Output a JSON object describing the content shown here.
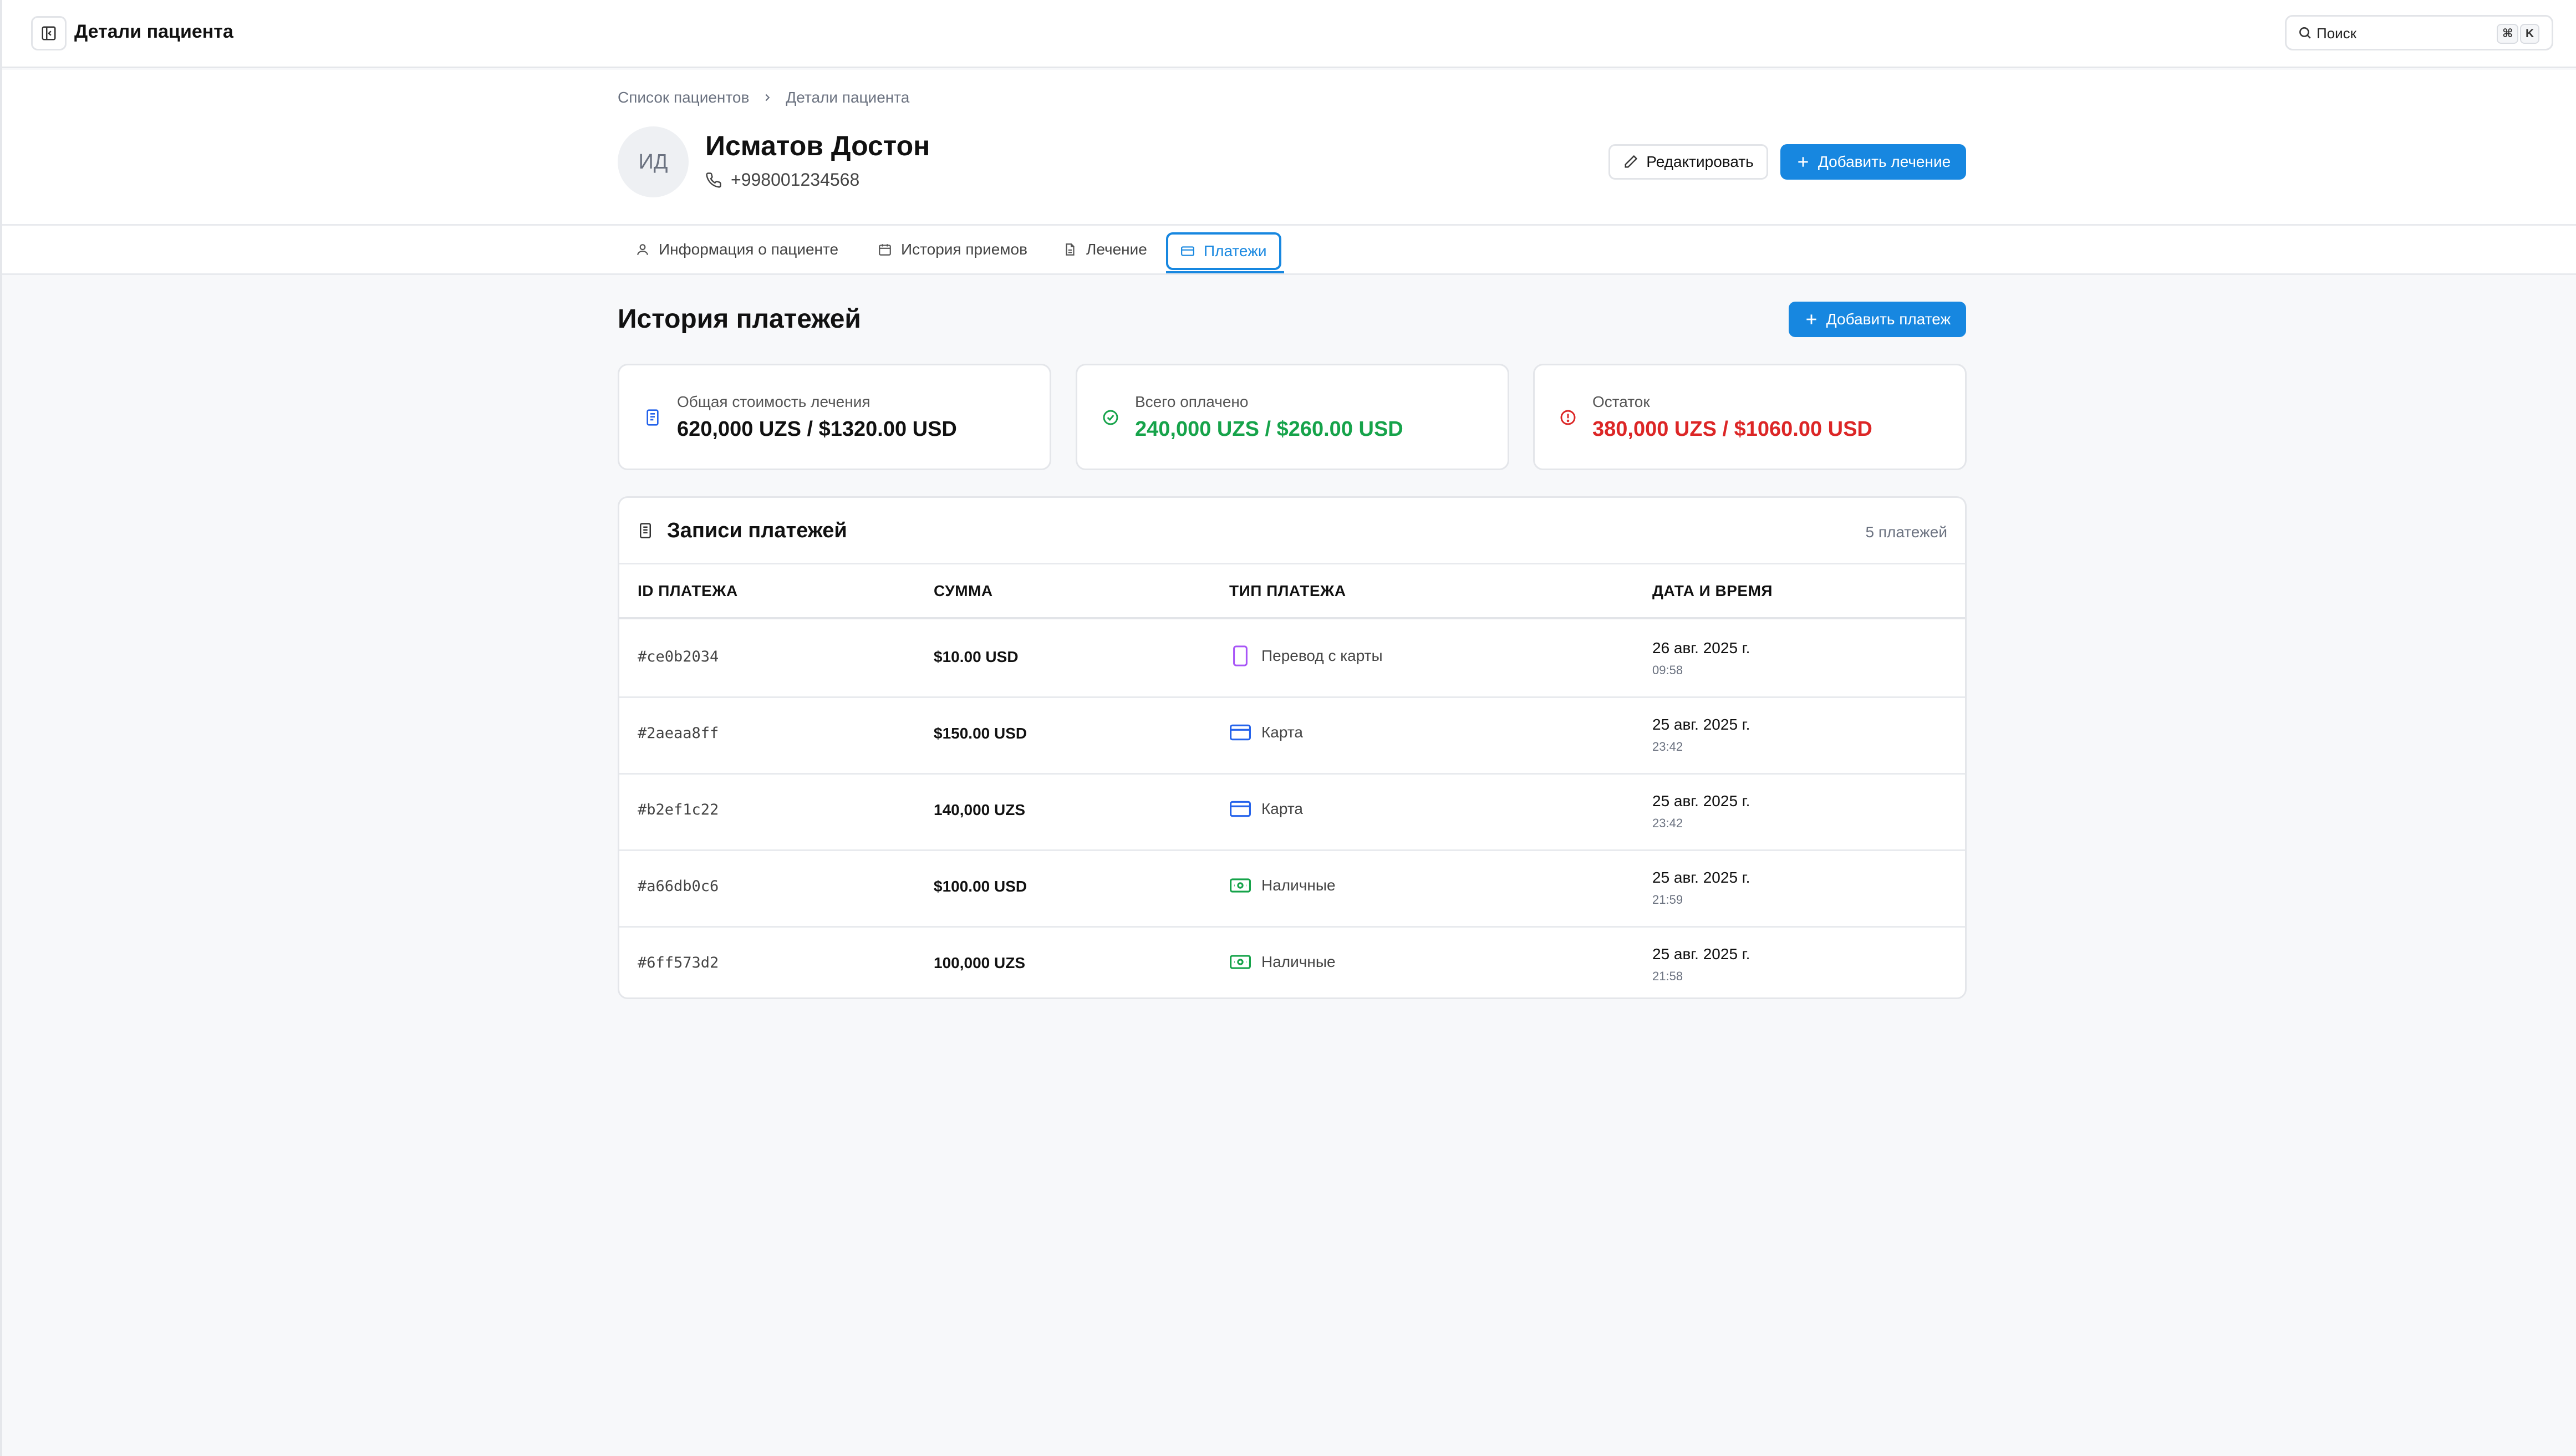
{
  "topbar": {
    "title": "Детали пациента",
    "search_placeholder": "Поиск",
    "shortcut_cmd": "⌘",
    "shortcut_key": "K"
  },
  "breadcrumb": {
    "parent": "Список пациентов",
    "current": "Детали пациента"
  },
  "patient": {
    "initials": "ИД",
    "name": "Исматов Достон",
    "phone": "+998001234568"
  },
  "actions": {
    "edit_label": "Редактировать",
    "add_treatment_label": "Добавить лечение"
  },
  "tabs": [
    {
      "label": "Информация о пациенте",
      "icon": "user-icon"
    },
    {
      "label": "История приемов",
      "icon": "calendar-icon"
    },
    {
      "label": "Лечение",
      "icon": "document-icon"
    },
    {
      "label": "Платежи",
      "icon": "credit-card-icon",
      "active": true
    }
  ],
  "payments": {
    "title": "История платежей",
    "add_payment_label": "Добавить платеж",
    "summary": {
      "total": {
        "label": "Общая стоимость лечения",
        "value": "620,000 UZS / $1320.00 USD",
        "color": "#111111",
        "icon": "receipt-icon"
      },
      "paid": {
        "label": "Всего оплачено",
        "value": "240,000 UZS / $260.00 USD",
        "color": "#16a34a",
        "icon": "check-circle-icon"
      },
      "rest": {
        "label": "Остаток",
        "value": "380,000 UZS / $1060.00 USD",
        "color": "#dc2626",
        "icon": "alert-circle-icon"
      }
    },
    "records": {
      "title": "Записи платежей",
      "count": "5 платежей",
      "columns": [
        "ID ПЛАТЕЖА",
        "СУММА",
        "ТИП ПЛАТЕЖА",
        "ДАТА И ВРЕМЯ"
      ],
      "rows": [
        {
          "id": "#ce0b2034",
          "amount": "$10.00 USD",
          "type": "Перевод с карты",
          "type_icon": "phone-icon",
          "date": "26 авг. 2025 г.",
          "time": "09:58"
        },
        {
          "id": "#2aeaa8ff",
          "amount": "$150.00 USD",
          "type": "Карта",
          "type_icon": "credit-card-icon",
          "date": "25 авг. 2025 г.",
          "time": "23:42"
        },
        {
          "id": "#b2ef1c22",
          "amount": "140,000 UZS",
          "type": "Карта",
          "type_icon": "credit-card-icon",
          "date": "25 авг. 2025 г.",
          "time": "23:42"
        },
        {
          "id": "#a66db0c6",
          "amount": "$100.00 USD",
          "type": "Наличные",
          "type_icon": "cash-icon",
          "date": "25 авг. 2025 г.",
          "time": "21:59"
        },
        {
          "id": "#6ff573d2",
          "amount": "100,000 UZS",
          "type": "Наличные",
          "type_icon": "cash-icon",
          "date": "25 авг. 2025 г.",
          "time": "21:58"
        }
      ]
    }
  },
  "colors": {
    "accent": "#1787e0",
    "transfer_icon": "#a855f7",
    "card_icon": "#2563eb",
    "cash_icon": "#16a34a"
  }
}
